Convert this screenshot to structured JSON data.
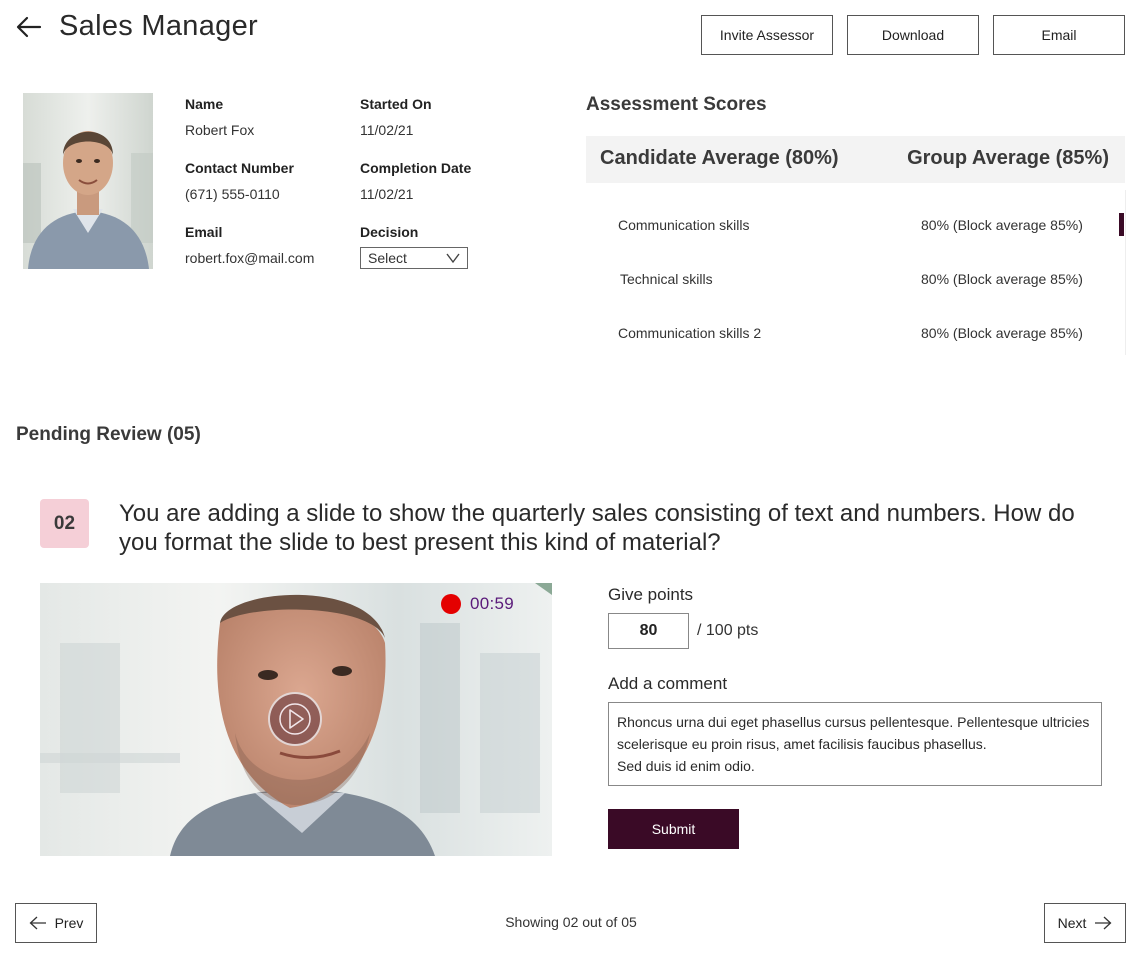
{
  "header": {
    "title": "Sales Manager",
    "buttons": {
      "invite": "Invite Assessor",
      "download": "Download",
      "email": "Email"
    }
  },
  "candidate": {
    "name_label": "Name",
    "name": "Robert Fox",
    "started_label": "Started On",
    "started": "11/02/21",
    "contact_label": "Contact Number",
    "contact": "(671) 555-0110",
    "completion_label": "Completion Date",
    "completion": "11/02/21",
    "email_label": "Email",
    "email": "robert.fox@mail.com",
    "decision_label": "Decision",
    "decision_value": "Select"
  },
  "assessment": {
    "title": "Assessment Scores",
    "candidate_avg": "Candidate Average (80%)",
    "group_avg": "Group Average (85%)",
    "rows": [
      {
        "name": "Communication skills",
        "value": "80% (Block average 85%)"
      },
      {
        "name": "Technical skills",
        "value": "80% (Block average 85%)"
      },
      {
        "name": "Communication skills 2",
        "value": "80% (Block average 85%)"
      }
    ]
  },
  "pending": {
    "title": "Pending Review (05)",
    "question_number": "02",
    "question": "You are adding a slide to show the quarterly sales consisting of text and numbers. How do you format the slide to best present this kind of material?",
    "recording_time": "00:59",
    "give_points_label": "Give points",
    "points_value": "80",
    "points_suffix": "/ 100 pts",
    "comment_label": "Add a comment",
    "comment": "Rhoncus urna dui eget phasellus cursus pellentesque. Pellentesque ultricies scelerisque eu proin risus, amet facilisis faucibus phasellus.\nSed duis id enim odio.",
    "submit": "Submit"
  },
  "footer": {
    "prev": "Prev",
    "next": "Next",
    "showing": "Showing 02 out of 05"
  },
  "colors": {
    "brand_dark": "#3a0a26",
    "badge_bg": "#f5cfd7",
    "record_red": "#e40000",
    "timer_purple": "#5a1a7a"
  },
  "icons": {
    "back": "arrow-left-icon",
    "select": "chevron-down-icon",
    "play": "play-icon",
    "prev": "arrow-left-icon",
    "next": "arrow-right-icon"
  }
}
